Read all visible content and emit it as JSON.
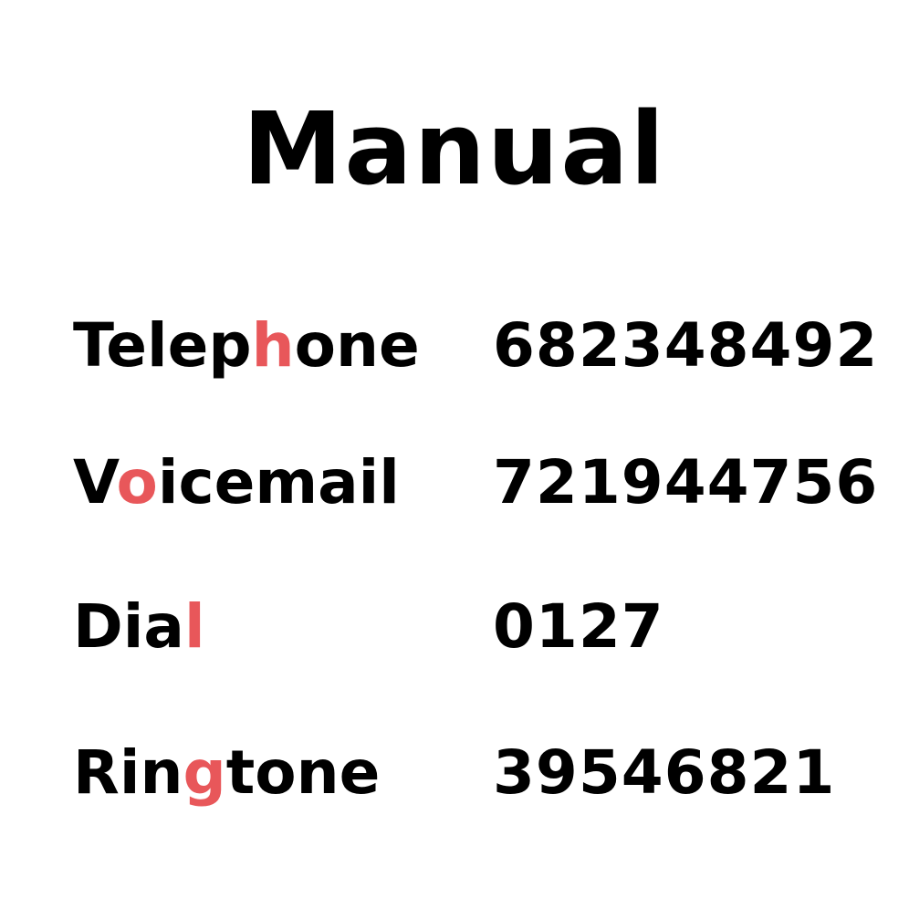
{
  "title": "Manual",
  "highlight_color": "#e8575a",
  "rows": [
    {
      "label_pre": "Telep",
      "label_hl": "h",
      "label_post": "one",
      "value": "682348492"
    },
    {
      "label_pre": "V",
      "label_hl": "o",
      "label_post": "icemail",
      "value": "721944756"
    },
    {
      "label_pre": "Dia",
      "label_hl": "l",
      "label_post": "",
      "value": "0127"
    },
    {
      "label_pre": "Rin",
      "label_hl": "g",
      "label_post": "tone",
      "value": "39546821"
    }
  ]
}
